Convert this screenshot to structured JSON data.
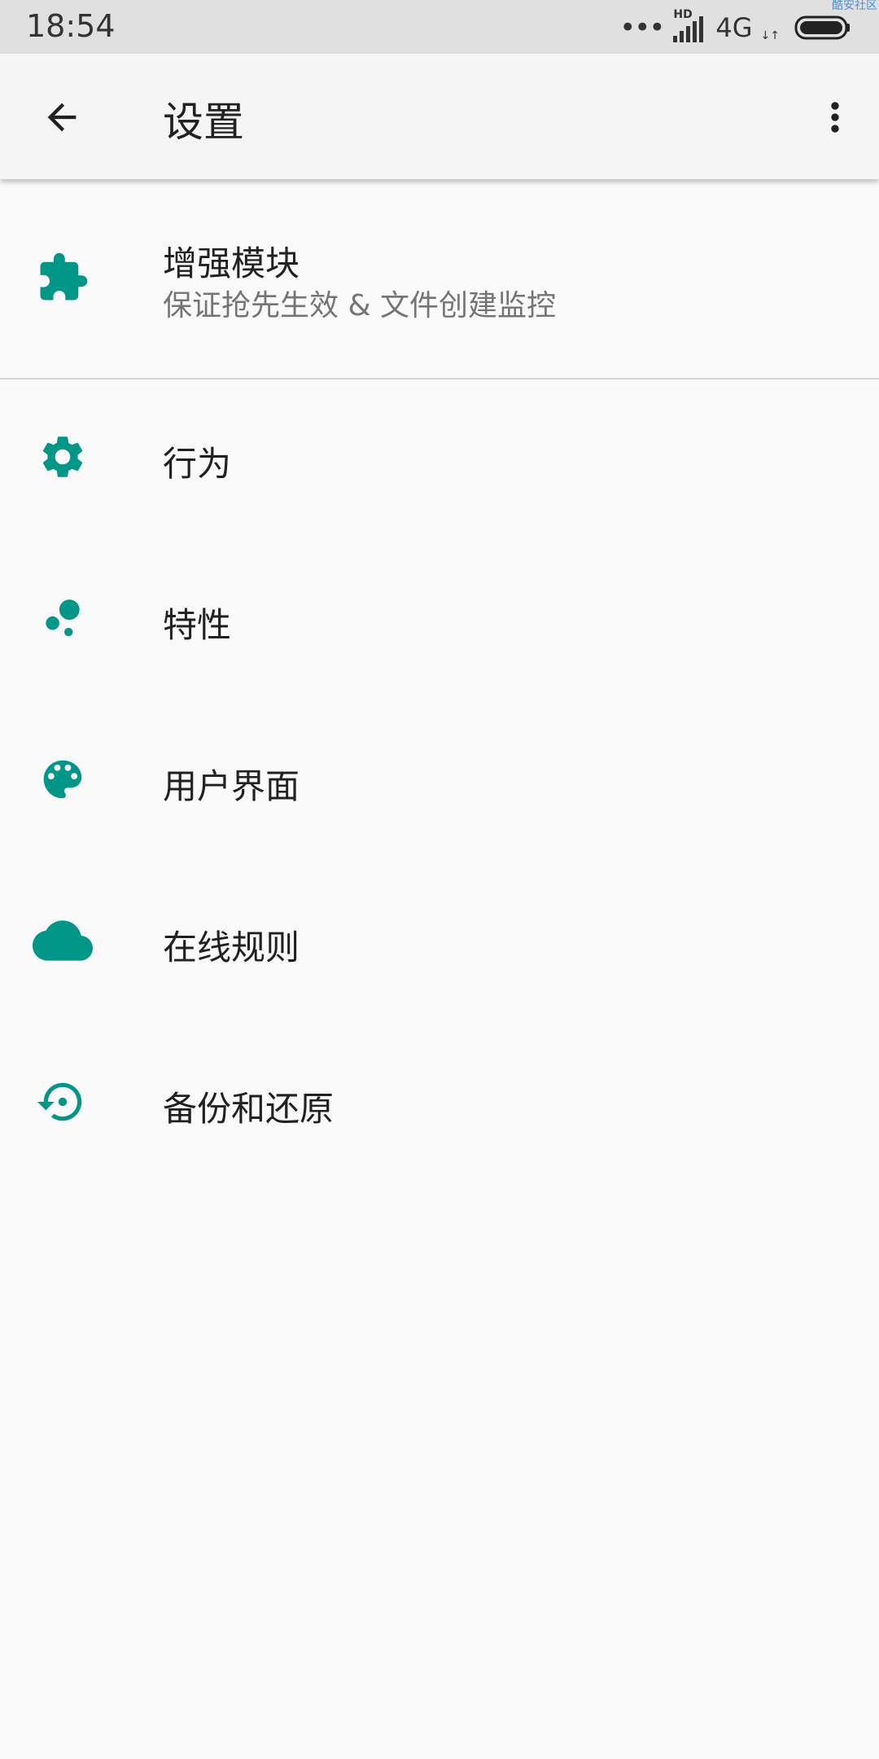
{
  "status_bar": {
    "time": "18:54",
    "dots": "•••",
    "hd": "HD",
    "network": "4G",
    "network_arrows": "↓↑",
    "watermark": "酷安社区"
  },
  "toolbar": {
    "title": "设置"
  },
  "items": [
    {
      "title": "增强模块",
      "subtitle": "保证抢先生效 & 文件创建监控",
      "icon": "puzzle-icon"
    },
    {
      "title": "行为",
      "icon": "gear-icon"
    },
    {
      "title": "特性",
      "icon": "bubbles-icon"
    },
    {
      "title": "用户界面",
      "icon": "palette-icon"
    },
    {
      "title": "在线规则",
      "icon": "cloud-icon"
    },
    {
      "title": "备份和还原",
      "icon": "restore-icon"
    }
  ],
  "colors": {
    "accent": "#009688",
    "toolbar": "#f5f5f5",
    "status_bar": "#e0e0e0",
    "background": "#fafafa"
  }
}
